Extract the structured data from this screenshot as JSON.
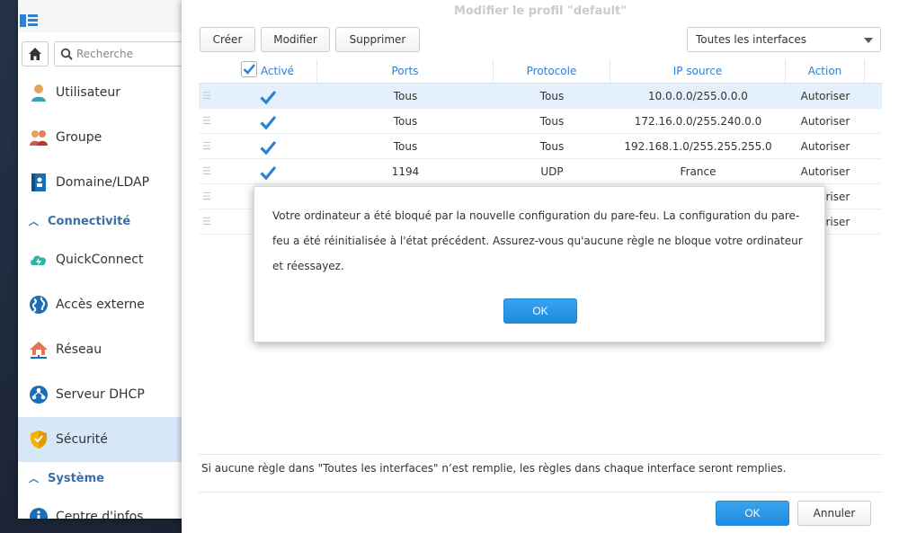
{
  "control_panel": {
    "search_placeholder": "Recherche",
    "nav": [
      {
        "label": "Utilisateur",
        "icon": "user-icon"
      },
      {
        "label": "Groupe",
        "icon": "group-icon"
      },
      {
        "label": "Domaine/LDAP",
        "icon": "domain-icon"
      }
    ],
    "section_connectivity": "Connectivité",
    "nav_connectivity": [
      {
        "label": "QuickConnect",
        "icon": "cloud-bolt-icon"
      },
      {
        "label": "Accès externe",
        "icon": "globe-icon"
      },
      {
        "label": "Réseau",
        "icon": "house-network-icon"
      },
      {
        "label": "Serveur DHCP",
        "icon": "dhcp-icon"
      },
      {
        "label": "Sécurité",
        "icon": "shield-icon",
        "active": true
      }
    ],
    "section_system": "Système",
    "nav_system": [
      {
        "label": "Centre d'infos",
        "icon": "info-icon"
      }
    ]
  },
  "dialog": {
    "title": "Modifier le profil \"default\"",
    "toolbar": {
      "create": "Créer",
      "modify": "Modifier",
      "delete": "Supprimer"
    },
    "interface_select": "Toutes les interfaces",
    "columns": {
      "enabled": "Activé",
      "ports": "Ports",
      "protocol": "Protocole",
      "source_ip": "IP source",
      "action": "Action"
    },
    "rows": [
      {
        "ports": "Tous",
        "protocol": "Tous",
        "ip": "10.0.0.0/255.0.0.0",
        "action": "Autoriser"
      },
      {
        "ports": "Tous",
        "protocol": "Tous",
        "ip": "172.16.0.0/255.240.0.0",
        "action": "Autoriser"
      },
      {
        "ports": "Tous",
        "protocol": "Tous",
        "ip": "192.168.1.0/255.255.255.0",
        "action": "Autoriser"
      },
      {
        "ports": "1194",
        "protocol": "UDP",
        "ip": "France",
        "action": "Autoriser"
      },
      {
        "ports": "",
        "protocol": "",
        "ip": "",
        "action": "Autoriser"
      },
      {
        "ports": "",
        "protocol": "",
        "ip": "",
        "action": "Autoriser"
      }
    ],
    "footnote": "Si aucune règle dans \"Toutes les interfaces\" n’est remplie, les règles dans chaque interface seront remplies.",
    "ok": "OK",
    "cancel": "Annuler"
  },
  "alert": {
    "line1": "Votre ordinateur a été bloqué par la nouvelle configuration du pare-feu. La configuration du pare-",
    "line2": "feu a été réinitialisée à l'état précédent. Assurez-vous qu'aucune règle ne bloque votre ordinateur",
    "line3": "et réessayez.",
    "ok": "OK"
  },
  "colors": {
    "accent": "#2f7fd2",
    "primary_button": "#1e8be0",
    "active_nav": "#d6e8f8"
  }
}
